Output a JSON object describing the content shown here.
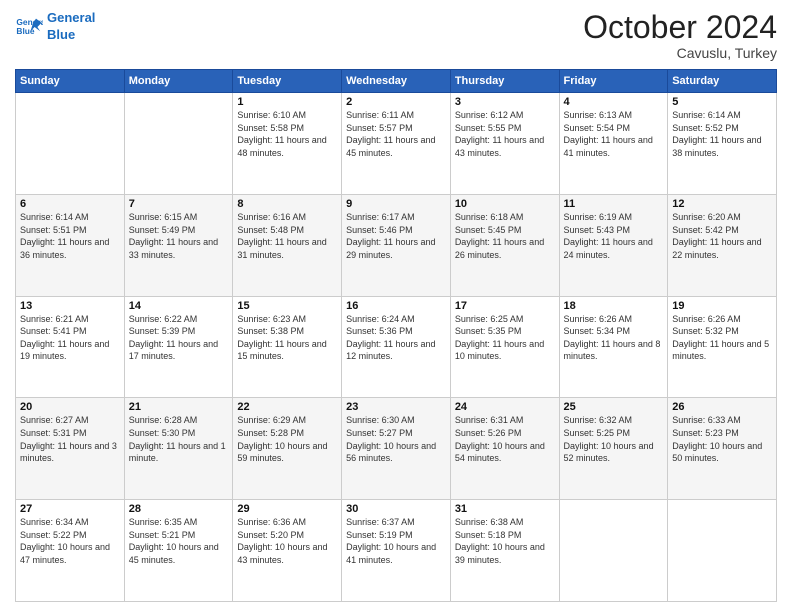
{
  "logo": {
    "line1": "General",
    "line2": "Blue"
  },
  "title": "October 2024",
  "location": "Cavuslu, Turkey",
  "days_header": [
    "Sunday",
    "Monday",
    "Tuesday",
    "Wednesday",
    "Thursday",
    "Friday",
    "Saturday"
  ],
  "weeks": [
    [
      null,
      null,
      {
        "day": "1",
        "sunrise": "6:10 AM",
        "sunset": "5:58 PM",
        "daylight": "11 hours and 48 minutes."
      },
      {
        "day": "2",
        "sunrise": "6:11 AM",
        "sunset": "5:57 PM",
        "daylight": "11 hours and 45 minutes."
      },
      {
        "day": "3",
        "sunrise": "6:12 AM",
        "sunset": "5:55 PM",
        "daylight": "11 hours and 43 minutes."
      },
      {
        "day": "4",
        "sunrise": "6:13 AM",
        "sunset": "5:54 PM",
        "daylight": "11 hours and 41 minutes."
      },
      {
        "day": "5",
        "sunrise": "6:14 AM",
        "sunset": "5:52 PM",
        "daylight": "11 hours and 38 minutes."
      }
    ],
    [
      {
        "day": "6",
        "sunrise": "6:14 AM",
        "sunset": "5:51 PM",
        "daylight": "11 hours and 36 minutes."
      },
      {
        "day": "7",
        "sunrise": "6:15 AM",
        "sunset": "5:49 PM",
        "daylight": "11 hours and 33 minutes."
      },
      {
        "day": "8",
        "sunrise": "6:16 AM",
        "sunset": "5:48 PM",
        "daylight": "11 hours and 31 minutes."
      },
      {
        "day": "9",
        "sunrise": "6:17 AM",
        "sunset": "5:46 PM",
        "daylight": "11 hours and 29 minutes."
      },
      {
        "day": "10",
        "sunrise": "6:18 AM",
        "sunset": "5:45 PM",
        "daylight": "11 hours and 26 minutes."
      },
      {
        "day": "11",
        "sunrise": "6:19 AM",
        "sunset": "5:43 PM",
        "daylight": "11 hours and 24 minutes."
      },
      {
        "day": "12",
        "sunrise": "6:20 AM",
        "sunset": "5:42 PM",
        "daylight": "11 hours and 22 minutes."
      }
    ],
    [
      {
        "day": "13",
        "sunrise": "6:21 AM",
        "sunset": "5:41 PM",
        "daylight": "11 hours and 19 minutes."
      },
      {
        "day": "14",
        "sunrise": "6:22 AM",
        "sunset": "5:39 PM",
        "daylight": "11 hours and 17 minutes."
      },
      {
        "day": "15",
        "sunrise": "6:23 AM",
        "sunset": "5:38 PM",
        "daylight": "11 hours and 15 minutes."
      },
      {
        "day": "16",
        "sunrise": "6:24 AM",
        "sunset": "5:36 PM",
        "daylight": "11 hours and 12 minutes."
      },
      {
        "day": "17",
        "sunrise": "6:25 AM",
        "sunset": "5:35 PM",
        "daylight": "11 hours and 10 minutes."
      },
      {
        "day": "18",
        "sunrise": "6:26 AM",
        "sunset": "5:34 PM",
        "daylight": "11 hours and 8 minutes."
      },
      {
        "day": "19",
        "sunrise": "6:26 AM",
        "sunset": "5:32 PM",
        "daylight": "11 hours and 5 minutes."
      }
    ],
    [
      {
        "day": "20",
        "sunrise": "6:27 AM",
        "sunset": "5:31 PM",
        "daylight": "11 hours and 3 minutes."
      },
      {
        "day": "21",
        "sunrise": "6:28 AM",
        "sunset": "5:30 PM",
        "daylight": "11 hours and 1 minute."
      },
      {
        "day": "22",
        "sunrise": "6:29 AM",
        "sunset": "5:28 PM",
        "daylight": "10 hours and 59 minutes."
      },
      {
        "day": "23",
        "sunrise": "6:30 AM",
        "sunset": "5:27 PM",
        "daylight": "10 hours and 56 minutes."
      },
      {
        "day": "24",
        "sunrise": "6:31 AM",
        "sunset": "5:26 PM",
        "daylight": "10 hours and 54 minutes."
      },
      {
        "day": "25",
        "sunrise": "6:32 AM",
        "sunset": "5:25 PM",
        "daylight": "10 hours and 52 minutes."
      },
      {
        "day": "26",
        "sunrise": "6:33 AM",
        "sunset": "5:23 PM",
        "daylight": "10 hours and 50 minutes."
      }
    ],
    [
      {
        "day": "27",
        "sunrise": "6:34 AM",
        "sunset": "5:22 PM",
        "daylight": "10 hours and 47 minutes."
      },
      {
        "day": "28",
        "sunrise": "6:35 AM",
        "sunset": "5:21 PM",
        "daylight": "10 hours and 45 minutes."
      },
      {
        "day": "29",
        "sunrise": "6:36 AM",
        "sunset": "5:20 PM",
        "daylight": "10 hours and 43 minutes."
      },
      {
        "day": "30",
        "sunrise": "6:37 AM",
        "sunset": "5:19 PM",
        "daylight": "10 hours and 41 minutes."
      },
      {
        "day": "31",
        "sunrise": "6:38 AM",
        "sunset": "5:18 PM",
        "daylight": "10 hours and 39 minutes."
      },
      null,
      null
    ]
  ],
  "labels": {
    "sunrise": "Sunrise:",
    "sunset": "Sunset:",
    "daylight": "Daylight:"
  }
}
